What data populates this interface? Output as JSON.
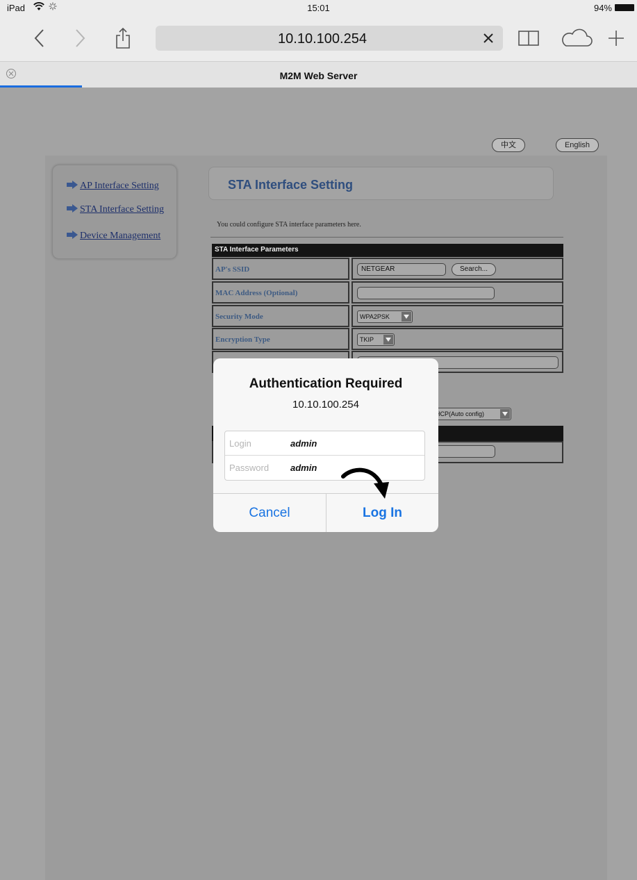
{
  "status_bar": {
    "carrier": "iPad",
    "time": "15:01",
    "battery": "94%"
  },
  "browser": {
    "url": "10.10.100.254",
    "tab_title": "M2M Web Server",
    "icons": [
      "back-icon",
      "forward-icon",
      "share-icon",
      "clear-icon",
      "bookmarks-icon",
      "cloud-icon",
      "plus-icon",
      "close-tab-icon"
    ]
  },
  "page": {
    "languages": {
      "chinese": "中文",
      "english": "English"
    },
    "menu": [
      {
        "label": "AP Interface Setting"
      },
      {
        "label": "STA Interface Setting"
      },
      {
        "label": "Device Management"
      }
    ],
    "section_title": "STA Interface Setting",
    "description": "You could configure STA interface parameters here.",
    "params_header": "STA Interface Parameters",
    "rows": [
      {
        "label": "AP's SSID",
        "value": "NETGEAR",
        "button": "Search..."
      },
      {
        "label": "MAC Address (Optional)",
        "value": ""
      },
      {
        "label": "Security Mode",
        "value": "WPA2PSK"
      },
      {
        "label": "Encryption Type",
        "value": "TKIP"
      }
    ],
    "wan_mode": "HCP(Auto config)"
  },
  "dialog": {
    "title": "Authentication Required",
    "host": "10.10.100.254",
    "login_placeholder": "Login",
    "login_value": "admin",
    "password_placeholder": "Password",
    "password_value": "admin",
    "cancel_label": "Cancel",
    "login_label": "Log In"
  },
  "colors": {
    "accent": "#1a74e2",
    "overlay_gray": "#a3a3a3",
    "link_blue": "#1d2f6b"
  }
}
